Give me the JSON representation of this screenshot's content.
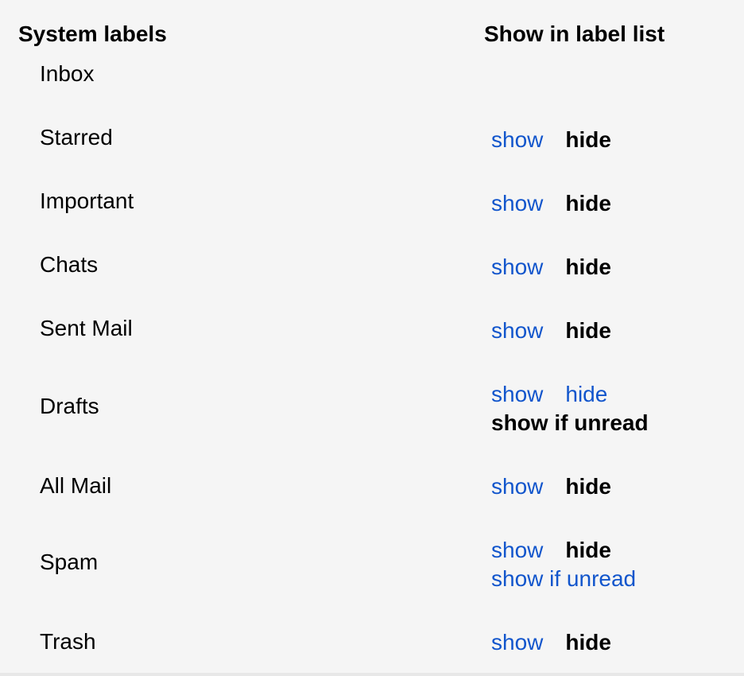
{
  "headers": {
    "left": "System labels",
    "right": "Show in label list"
  },
  "labels": [
    {
      "name": "Inbox",
      "options": []
    },
    {
      "name": "Starred",
      "options": [
        [
          {
            "text": "show",
            "selected": false
          },
          {
            "text": "hide",
            "selected": true
          }
        ]
      ]
    },
    {
      "name": "Important",
      "options": [
        [
          {
            "text": "show",
            "selected": false
          },
          {
            "text": "hide",
            "selected": true
          }
        ]
      ]
    },
    {
      "name": "Chats",
      "options": [
        [
          {
            "text": "show",
            "selected": false
          },
          {
            "text": "hide",
            "selected": true
          }
        ]
      ]
    },
    {
      "name": "Sent Mail",
      "options": [
        [
          {
            "text": "show",
            "selected": false
          },
          {
            "text": "hide",
            "selected": true
          }
        ]
      ]
    },
    {
      "name": "Drafts",
      "options": [
        [
          {
            "text": "show",
            "selected": false
          },
          {
            "text": "hide",
            "selected": false
          }
        ],
        [
          {
            "text": "show if unread",
            "selected": true
          }
        ]
      ]
    },
    {
      "name": "All Mail",
      "options": [
        [
          {
            "text": "show",
            "selected": false
          },
          {
            "text": "hide",
            "selected": true
          }
        ]
      ]
    },
    {
      "name": "Spam",
      "options": [
        [
          {
            "text": "show",
            "selected": false
          },
          {
            "text": "hide",
            "selected": true
          }
        ],
        [
          {
            "text": "show if unread",
            "selected": false
          }
        ]
      ]
    },
    {
      "name": "Trash",
      "options": [
        [
          {
            "text": "show",
            "selected": false
          },
          {
            "text": "hide",
            "selected": true
          }
        ]
      ]
    }
  ],
  "colors": {
    "link": "#1155cc",
    "selected": "#000000",
    "background": "#f5f5f5"
  }
}
